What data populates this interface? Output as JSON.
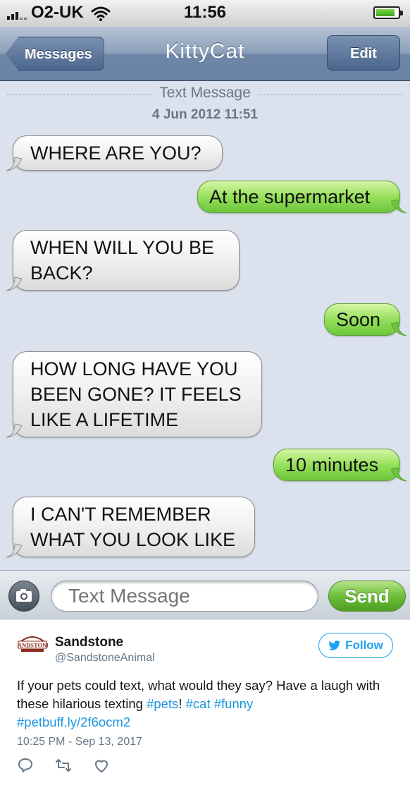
{
  "status": {
    "carrier": "O2-UK",
    "time": "11:56"
  },
  "nav": {
    "back_label": "Messages",
    "title": "KittyCat",
    "edit_label": "Edit"
  },
  "thread": {
    "label": "Text Message",
    "timestamp": "4 Jun 2012 11:51"
  },
  "messages": [
    {
      "side": "in",
      "lines": [
        "WHERE ARE YOU?"
      ]
    },
    {
      "side": "out",
      "lines": [
        "At the supermarket"
      ]
    },
    {
      "side": "in",
      "lines": [
        "WHEN WILL YOU BE",
        "BACK?"
      ]
    },
    {
      "side": "out",
      "lines": [
        "Soon"
      ]
    },
    {
      "side": "in",
      "lines": [
        "HOW LONG HAVE YOU",
        "BEEN GONE? IT FEELS",
        "LIKE A LIFETIME"
      ]
    },
    {
      "side": "out",
      "lines": [
        "10 minutes"
      ]
    },
    {
      "side": "in",
      "lines": [
        "I CAN'T REMEMBER",
        "WHAT YOU LOOK LIKE"
      ]
    }
  ],
  "composer": {
    "placeholder": "Text Message",
    "send_label": "Send"
  },
  "tweet": {
    "author_name": "Sandstone",
    "author_handle": "@SandstoneAnimal",
    "follow_label": "Follow",
    "text_plain_1": "If your pets could text, what would they say? Have a laugh with these hilarious texting ",
    "tag_pets": "#pets",
    "text_plain_2": "! ",
    "tag_cat": "#cat",
    "tag_funny": "#funny",
    "link": "#petbuff.ly/2f6ocm2",
    "timestamp": "10:25 PM - Sep 13, 2017",
    "avatar_text": "SANDSTONE"
  },
  "colors": {
    "incoming_bubble": "#f0f0f0",
    "outgoing_bubble": "#96e05b",
    "navbar": "#6e86a6",
    "twitter_blue": "#1da1f2"
  }
}
